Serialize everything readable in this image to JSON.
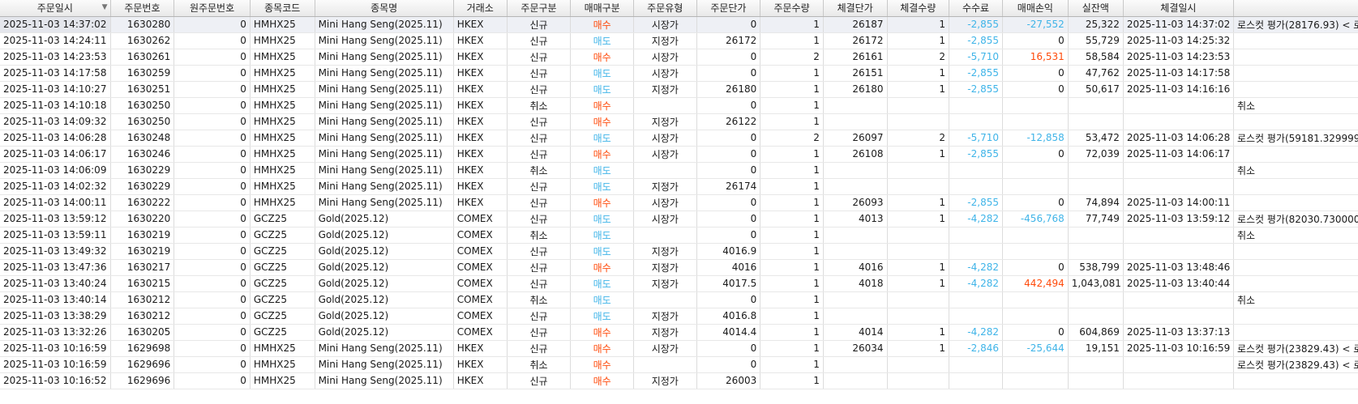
{
  "columns": [
    "주문일시",
    "주문번호",
    "원주문번호",
    "종목코드",
    "종목명",
    "거래소",
    "주문구분",
    "매매구분",
    "주문유형",
    "주문단가",
    "주문수량",
    "체결단가",
    "체결수량",
    "수수료",
    "매매손익",
    "실잔액",
    "체결일시",
    ""
  ],
  "filter_icon": "▼",
  "rows": [
    [
      "2025-11-03 14:37:02",
      "1630280",
      "0",
      "HMHX25",
      "Mini Hang Seng(2025.11)",
      "HKEX",
      "신규",
      "매수",
      "시장가",
      "0",
      "1",
      "26187",
      "1",
      "-2,855",
      "-27,552",
      "25,322",
      "2025-11-03 14:37:02",
      "로스컷 평가(28176.93) < 로"
    ],
    [
      "2025-11-03 14:24:11",
      "1630262",
      "0",
      "HMHX25",
      "Mini Hang Seng(2025.11)",
      "HKEX",
      "신규",
      "매도",
      "지정가",
      "26172",
      "1",
      "26172",
      "1",
      "-2,855",
      "0",
      "55,729",
      "2025-11-03 14:25:32",
      ""
    ],
    [
      "2025-11-03 14:23:53",
      "1630261",
      "0",
      "HMHX25",
      "Mini Hang Seng(2025.11)",
      "HKEX",
      "신규",
      "매수",
      "시장가",
      "0",
      "2",
      "26161",
      "2",
      "-5,710",
      "16,531",
      "58,584",
      "2025-11-03 14:23:53",
      ""
    ],
    [
      "2025-11-03 14:17:58",
      "1630259",
      "0",
      "HMHX25",
      "Mini Hang Seng(2025.11)",
      "HKEX",
      "신규",
      "매도",
      "시장가",
      "0",
      "1",
      "26151",
      "1",
      "-2,855",
      "0",
      "47,762",
      "2025-11-03 14:17:58",
      ""
    ],
    [
      "2025-11-03 14:10:27",
      "1630251",
      "0",
      "HMHX25",
      "Mini Hang Seng(2025.11)",
      "HKEX",
      "신규",
      "매도",
      "지정가",
      "26180",
      "1",
      "26180",
      "1",
      "-2,855",
      "0",
      "50,617",
      "2025-11-03 14:16:16",
      ""
    ],
    [
      "2025-11-03 14:10:18",
      "1630250",
      "0",
      "HMHX25",
      "Mini Hang Seng(2025.11)",
      "HKEX",
      "취소",
      "매수",
      "",
      "0",
      "1",
      "",
      "",
      "",
      "",
      "",
      "",
      "취소"
    ],
    [
      "2025-11-03 14:09:32",
      "1630250",
      "0",
      "HMHX25",
      "Mini Hang Seng(2025.11)",
      "HKEX",
      "신규",
      "매수",
      "지정가",
      "26122",
      "1",
      "",
      "",
      "",
      "",
      "",
      "",
      ""
    ],
    [
      "2025-11-03 14:06:28",
      "1630248",
      "0",
      "HMHX25",
      "Mini Hang Seng(2025.11)",
      "HKEX",
      "신규",
      "매도",
      "시장가",
      "0",
      "2",
      "26097",
      "2",
      "-5,710",
      "-12,858",
      "53,472",
      "2025-11-03 14:06:28",
      "로스컷 평가(59181.329999"
    ],
    [
      "2025-11-03 14:06:17",
      "1630246",
      "0",
      "HMHX25",
      "Mini Hang Seng(2025.11)",
      "HKEX",
      "신규",
      "매수",
      "시장가",
      "0",
      "1",
      "26108",
      "1",
      "-2,855",
      "0",
      "72,039",
      "2025-11-03 14:06:17",
      ""
    ],
    [
      "2025-11-03 14:06:09",
      "1630229",
      "0",
      "HMHX25",
      "Mini Hang Seng(2025.11)",
      "HKEX",
      "취소",
      "매도",
      "",
      "0",
      "1",
      "",
      "",
      "",
      "",
      "",
      "",
      "취소"
    ],
    [
      "2025-11-03 14:02:32",
      "1630229",
      "0",
      "HMHX25",
      "Mini Hang Seng(2025.11)",
      "HKEX",
      "신규",
      "매도",
      "지정가",
      "26174",
      "1",
      "",
      "",
      "",
      "",
      "",
      "",
      ""
    ],
    [
      "2025-11-03 14:00:11",
      "1630222",
      "0",
      "HMHX25",
      "Mini Hang Seng(2025.11)",
      "HKEX",
      "신규",
      "매수",
      "시장가",
      "0",
      "1",
      "26093",
      "1",
      "-2,855",
      "0",
      "74,894",
      "2025-11-03 14:00:11",
      ""
    ],
    [
      "2025-11-03 13:59:12",
      "1630220",
      "0",
      "GCZ25",
      "Gold(2025.12)",
      "COMEX",
      "신규",
      "매도",
      "시장가",
      "0",
      "1",
      "4013",
      "1",
      "-4,282",
      "-456,768",
      "77,749",
      "2025-11-03 13:59:12",
      "로스컷 평가(82030.730000"
    ],
    [
      "2025-11-03 13:59:11",
      "1630219",
      "0",
      "GCZ25",
      "Gold(2025.12)",
      "COMEX",
      "취소",
      "매도",
      "",
      "0",
      "1",
      "",
      "",
      "",
      "",
      "",
      "",
      "취소"
    ],
    [
      "2025-11-03 13:49:32",
      "1630219",
      "0",
      "GCZ25",
      "Gold(2025.12)",
      "COMEX",
      "신규",
      "매도",
      "지정가",
      "4016.9",
      "1",
      "",
      "",
      "",
      "",
      "",
      "",
      ""
    ],
    [
      "2025-11-03 13:47:36",
      "1630217",
      "0",
      "GCZ25",
      "Gold(2025.12)",
      "COMEX",
      "신규",
      "매수",
      "지정가",
      "4016",
      "1",
      "4016",
      "1",
      "-4,282",
      "0",
      "538,799",
      "2025-11-03 13:48:46",
      ""
    ],
    [
      "2025-11-03 13:40:24",
      "1630215",
      "0",
      "GCZ25",
      "Gold(2025.12)",
      "COMEX",
      "신규",
      "매도",
      "지정가",
      "4017.5",
      "1",
      "4018",
      "1",
      "-4,282",
      "442,494",
      "1,043,081",
      "2025-11-03 13:40:44",
      ""
    ],
    [
      "2025-11-03 13:40:14",
      "1630212",
      "0",
      "GCZ25",
      "Gold(2025.12)",
      "COMEX",
      "취소",
      "매도",
      "",
      "0",
      "1",
      "",
      "",
      "",
      "",
      "",
      "",
      "취소"
    ],
    [
      "2025-11-03 13:38:29",
      "1630212",
      "0",
      "GCZ25",
      "Gold(2025.12)",
      "COMEX",
      "신규",
      "매도",
      "지정가",
      "4016.8",
      "1",
      "",
      "",
      "",
      "",
      "",
      "",
      ""
    ],
    [
      "2025-11-03 13:32:26",
      "1630205",
      "0",
      "GCZ25",
      "Gold(2025.12)",
      "COMEX",
      "신규",
      "매수",
      "지정가",
      "4014.4",
      "1",
      "4014",
      "1",
      "-4,282",
      "0",
      "604,869",
      "2025-11-03 13:37:13",
      ""
    ],
    [
      "2025-11-03 10:16:59",
      "1629698",
      "0",
      "HMHX25",
      "Mini Hang Seng(2025.11)",
      "HKEX",
      "신규",
      "매수",
      "시장가",
      "0",
      "1",
      "26034",
      "1",
      "-2,846",
      "-25,644",
      "19,151",
      "2025-11-03 10:16:59",
      "로스컷 평가(23829.43) < 로"
    ],
    [
      "2025-11-03 10:16:59",
      "1629696",
      "0",
      "HMHX25",
      "Mini Hang Seng(2025.11)",
      "HKEX",
      "취소",
      "매수",
      "",
      "0",
      "1",
      "",
      "",
      "",
      "",
      "",
      "",
      "로스컷 평가(23829.43) < 로"
    ],
    [
      "2025-11-03 10:16:52",
      "1629696",
      "0",
      "HMHX25",
      "Mini Hang Seng(2025.11)",
      "HKEX",
      "신규",
      "매수",
      "지정가",
      "26003",
      "1",
      "",
      "",
      "",
      "",
      "",
      "",
      ""
    ]
  ],
  "colors": {
    "buy": "#ff4a0a",
    "sell": "#3fb4e8",
    "header_bg": "#ececec",
    "selected_row": "#eef0f5"
  }
}
